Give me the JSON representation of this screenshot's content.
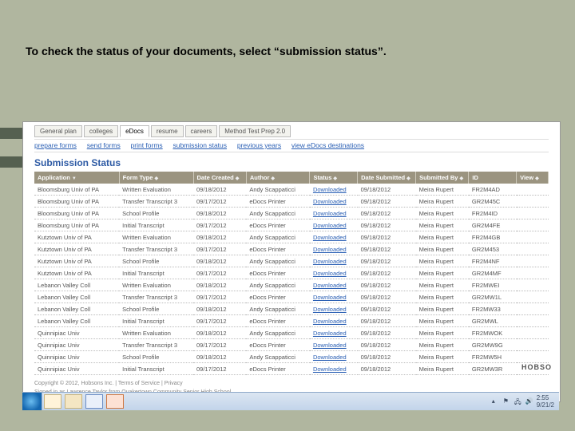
{
  "headline": "To check the status of your documents, select “submission status”.",
  "tabs": {
    "t0": "General plan",
    "t1": "colleges",
    "t2": "eDocs",
    "t3": "resume",
    "t4": "careers",
    "t5": "Method Test Prep 2.0"
  },
  "bluenav": {
    "n0": "prepare forms",
    "n1": "send forms",
    "n2": "print forms",
    "n3": "submission status",
    "n4": "previous years",
    "n5": "view eDocs destinations"
  },
  "section_title": "Submission Status",
  "cols": {
    "c0": "Application",
    "c1": "Form Type",
    "c2": "Date Created",
    "c3": "Author",
    "c4": "Status",
    "c5": "Date Submitted",
    "c6": "Submitted By",
    "c7": "ID",
    "c8": "View"
  },
  "rows": [
    {
      "app": "Bloomsburg Univ of PA",
      "ft": "Written Evaluation",
      "dc": "09/18/2012",
      "au": "Andy Scappaticci",
      "st": "Downloaded",
      "ds": "09/18/2012",
      "sb": "Meira Rupert",
      "id": "FR2M4AD"
    },
    {
      "app": "Bloomsburg Univ of PA",
      "ft": "Transfer Transcript 3",
      "dc": "09/17/2012",
      "au": "eDocs Printer",
      "st": "Downloaded",
      "ds": "09/18/2012",
      "sb": "Meira Rupert",
      "id": "GR2M45C"
    },
    {
      "app": "Bloomsburg Univ of PA",
      "ft": "School Profile",
      "dc": "09/18/2012",
      "au": "Andy Scappaticci",
      "st": "Downloaded",
      "ds": "09/18/2012",
      "sb": "Meira Rupert",
      "id": "FR2M4ID"
    },
    {
      "app": "Bloomsburg Univ of PA",
      "ft": "Initial Transcript",
      "dc": "09/17/2012",
      "au": "eDocs Printer",
      "st": "Downloaded",
      "ds": "09/18/2012",
      "sb": "Meira Rupert",
      "id": "GR2M4FE"
    },
    {
      "app": "Kutztown Univ of PA",
      "ft": "Written Evaluation",
      "dc": "09/18/2012",
      "au": "Andy Scappaticci",
      "st": "Downloaded",
      "ds": "09/18/2012",
      "sb": "Meira Rupert",
      "id": "FR2M4GB"
    },
    {
      "app": "Kutztown Univ of PA",
      "ft": "Transfer Transcript 3",
      "dc": "09/17/2012",
      "au": "eDocs Printer",
      "st": "Downloaded",
      "ds": "09/18/2012",
      "sb": "Meira Rupert",
      "id": "GR2M453"
    },
    {
      "app": "Kutztown Univ of PA",
      "ft": "School Profile",
      "dc": "09/18/2012",
      "au": "Andy Scappaticci",
      "st": "Downloaded",
      "ds": "09/18/2012",
      "sb": "Meira Rupert",
      "id": "FR2M4NF"
    },
    {
      "app": "Kutztown Univ of PA",
      "ft": "Initial Transcript",
      "dc": "09/17/2012",
      "au": "eDocs Printer",
      "st": "Downloaded",
      "ds": "09/18/2012",
      "sb": "Meira Rupert",
      "id": "GR2M4MF"
    },
    {
      "app": "Lebanon Valley Coll",
      "ft": "Written Evaluation",
      "dc": "09/18/2012",
      "au": "Andy Scappaticci",
      "st": "Downloaded",
      "ds": "09/18/2012",
      "sb": "Meira Rupert",
      "id": "FR2MWEI"
    },
    {
      "app": "Lebanon Valley Coll",
      "ft": "Transfer Transcript 3",
      "dc": "09/17/2012",
      "au": "eDocs Printer",
      "st": "Downloaded",
      "ds": "09/18/2012",
      "sb": "Meira Rupert",
      "id": "GR2MW1L"
    },
    {
      "app": "Lebanon Valley Coll",
      "ft": "School Profile",
      "dc": "09/18/2012",
      "au": "Andy Scappaticci",
      "st": "Downloaded",
      "ds": "09/18/2012",
      "sb": "Meira Rupert",
      "id": "FR2MW33"
    },
    {
      "app": "Lebanon Valley Coll",
      "ft": "Initial Transcript",
      "dc": "09/17/2012",
      "au": "eDocs Printer",
      "st": "Downloaded",
      "ds": "09/18/2012",
      "sb": "Meira Rupert",
      "id": "GR2MWL"
    },
    {
      "app": "Quinnipiac Univ",
      "ft": "Written Evaluation",
      "dc": "09/18/2012",
      "au": "Andy Scappaticci",
      "st": "Downloaded",
      "ds": "09/18/2012",
      "sb": "Meira Rupert",
      "id": "FR2MWOK"
    },
    {
      "app": "Quinnipiac Univ",
      "ft": "Transfer Transcript 3",
      "dc": "09/17/2012",
      "au": "eDocs Printer",
      "st": "Downloaded",
      "ds": "09/18/2012",
      "sb": "Meira Rupert",
      "id": "GR2MW9G"
    },
    {
      "app": "Quinnipiac Univ",
      "ft": "School Profile",
      "dc": "09/18/2012",
      "au": "Andy Scappaticci",
      "st": "Downloaded",
      "ds": "09/18/2012",
      "sb": "Meira Rupert",
      "id": "FR2MW5H"
    },
    {
      "app": "Quinnipiac Univ",
      "ft": "Initial Transcript",
      "dc": "09/17/2012",
      "au": "eDocs Printer",
      "st": "Downloaded",
      "ds": "09/18/2012",
      "sb": "Meira Rupert",
      "id": "GR2MW3R"
    }
  ],
  "footer": {
    "copyright": "Copyright © 2012, Hobsons Inc. | Terms of Service | Privacy",
    "signed": "Signed in as Lawrence Taylor from Quakertown Community Senior High School"
  },
  "brand": "HOBSO",
  "tray": {
    "time": "2:55",
    "date": "9/21/2"
  }
}
